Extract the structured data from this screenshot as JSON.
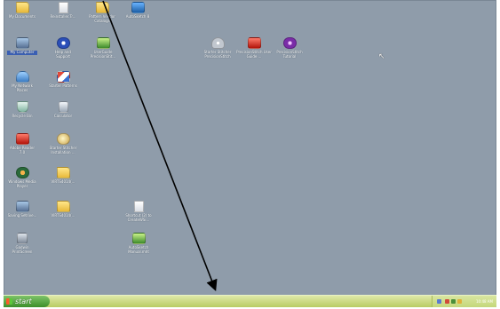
{
  "desktop": {
    "background_color": "#8f9caa",
    "icons": [
      {
        "label": "My Documents",
        "glyph": "folder-icon",
        "style": "g-folder",
        "selected": false
      },
      {
        "label": "Reinstaller.Tr...",
        "glyph": "document-icon",
        "style": "g-doc",
        "selected": false
      },
      {
        "label": "Pattern Vendor Catalogs",
        "glyph": "folder-icon",
        "style": "g-folder",
        "selected": false
      },
      {
        "label": "AutoSketch 8",
        "glyph": "autosketch-icon",
        "style": "g-autosketch",
        "selected": false
      },
      {
        "label": "My Computer",
        "glyph": "computer-icon",
        "style": "g-pc",
        "selected": true
      },
      {
        "label": "Help and Support",
        "glyph": "help-icon",
        "style": "g-help",
        "selected": false
      },
      {
        "label": "UserGuide PrecisionStit...",
        "glyph": "document-icon",
        "style": "g-green",
        "selected": false
      },
      {
        "label": "Starter Stitcher PrecisionStitch",
        "glyph": "stitcher-icon",
        "style": "g-disk",
        "selected": false
      },
      {
        "label": "PrecisionStitch User Guide ...",
        "glyph": "pdf-icon",
        "style": "g-red",
        "selected": false
      },
      {
        "label": "PrecisionStitch Tutorial",
        "glyph": "tutorial-icon",
        "style": "g-purple",
        "selected": false
      },
      {
        "label": "My Network Places",
        "glyph": "network-icon",
        "style": "g-net",
        "selected": false
      },
      {
        "label": "Starter Patterns",
        "glyph": "pattern-icon",
        "style": "g-pattern",
        "selected": false
      },
      {
        "label": "Recycle Bin",
        "glyph": "recycle-bin-icon",
        "style": "g-bin",
        "selected": false
      },
      {
        "label": "Calculator",
        "glyph": "calculator-icon",
        "style": "g-calc",
        "selected": false
      },
      {
        "label": "Adobe Reader 7.0",
        "glyph": "adobe-reader-icon",
        "style": "g-red",
        "selected": false
      },
      {
        "label": "Starter Stitcher Installation ...",
        "glyph": "stitcher-icon",
        "style": "g-stitch",
        "selected": false
      },
      {
        "label": "Windows Media Player",
        "glyph": "media-player-icon",
        "style": "g-media",
        "selected": false
      },
      {
        "label": "VIRTS4014(...",
        "glyph": "folder-icon",
        "style": "g-folder",
        "selected": false
      },
      {
        "label": "Saving Setrive...",
        "glyph": "shortcut-icon",
        "style": "g-pc",
        "selected": false
      },
      {
        "label": "VIRTS4014(...",
        "glyph": "folder-icon",
        "style": "g-folder",
        "selected": false
      },
      {
        "label": "Shortcut (2) to CreateWSi...",
        "glyph": "document-icon",
        "style": "g-doc",
        "selected": false
      },
      {
        "label": "Gadwin PrintScreen",
        "glyph": "camera-icon",
        "style": "g-camera",
        "selected": false
      },
      {
        "label": "AutoSketch Manual.mht",
        "glyph": "document-icon",
        "style": "g-green",
        "selected": false
      }
    ]
  },
  "taskbar": {
    "start_label": "start",
    "clock": "10:48 AM"
  },
  "colors": {
    "taskbar": "#c4d77a",
    "start_button": "#3c8f2a",
    "selection": "#3a5fb4"
  }
}
